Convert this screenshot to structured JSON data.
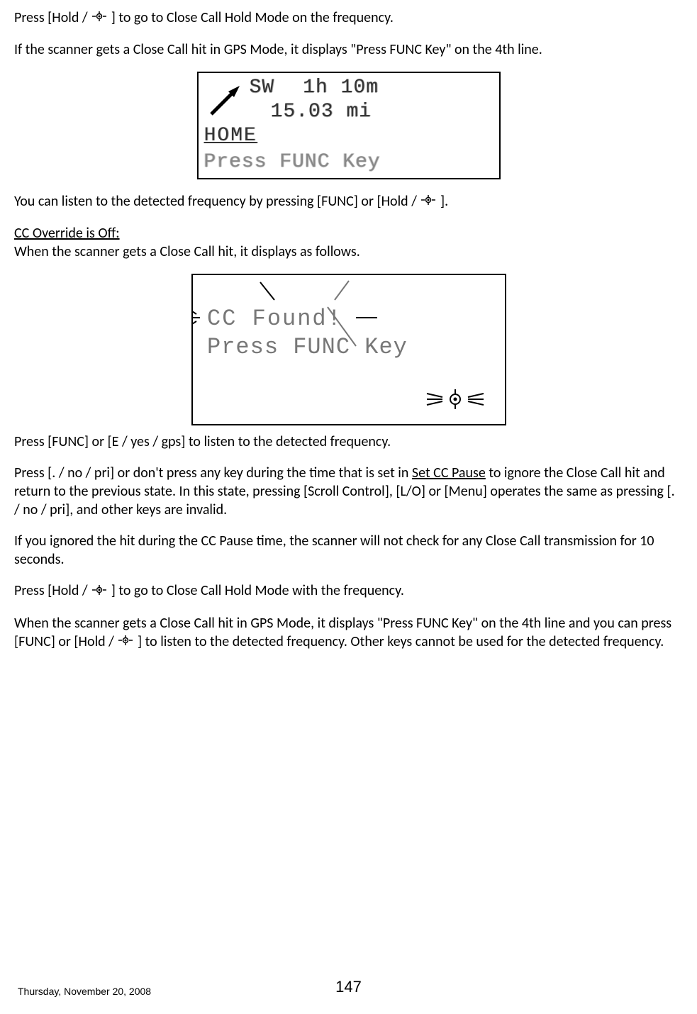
{
  "para": {
    "p1a": "Press [Hold / ",
    "p1b": "] to go to Close Call Hold Mode on the frequency.",
    "p2": "If the scanner gets a Close Call hit in GPS Mode, it displays \"Press FUNC Key\" on the 4th line.",
    "p3a": "You can listen to the detected frequency by pressing [FUNC] or [Hold / ",
    "p3b": "].",
    "p4_heading": "CC Override is Off:",
    "p4_body": "When the scanner gets a Close Call hit, it displays as follows.",
    "p5": "Press [FUNC] or [E / yes / gps] to listen to the detected frequency.",
    "p6a": "Press [. / no / pri] or don't press any key during the time that is set in ",
    "p6_link": "Set CC Pause",
    "p6b": " to ignore the Close Call hit and return to the previous state. In this state, pressing [Scroll Control], [L/O] or [Menu] operates the same as pressing [. / no / pri], and other keys are invalid.",
    "p7": "If you ignored the hit during the CC Pause time, the scanner will not check for any Close Call transmission for 10 seconds.",
    "p8a": "Press [Hold / ",
    "p8b": "] to go to Close Call Hold Mode with the frequency.",
    "p9a": "When the scanner gets a Close Call hit in GPS Mode, it displays \"Press FUNC Key\" on the 4th line and you can press [FUNC] or [Hold / ",
    "p9b": "] to listen to the detected frequency. Other keys cannot be used for the detected frequency."
  },
  "lcd1": {
    "direction": "SW",
    "time": "1h 10m",
    "distance": "15.03 mi",
    "home": "HOME",
    "press": "Press FUNC Key"
  },
  "lcd2": {
    "line1": "CC Found!",
    "line2": "Press FUNC Key"
  },
  "footer": {
    "date": "Thursday, November 20, 2008",
    "page": "147"
  }
}
